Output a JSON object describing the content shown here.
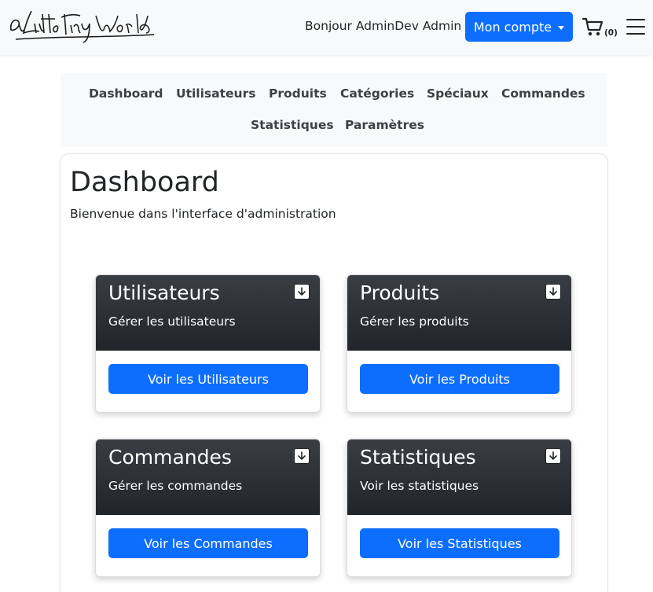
{
  "header": {
    "logo_text": "a Little Tiny World",
    "greeting": "Bonjour AdminDev Admin",
    "account_button": "Mon compte",
    "cart_count": "(0)",
    "accent_color": "#0d6efd"
  },
  "nav": {
    "items": [
      {
        "label": "Dashboard"
      },
      {
        "label": "Utilisateurs"
      },
      {
        "label": "Produits"
      },
      {
        "label": "Catégories"
      },
      {
        "label": "Spéciaux"
      },
      {
        "label": "Commandes"
      },
      {
        "label": "Statistiques"
      },
      {
        "label": "Paramètres"
      }
    ]
  },
  "main": {
    "title": "Dashboard",
    "subtitle": "Bienvenue dans l'interface d'administration",
    "cards": [
      {
        "title": "Utilisateurs",
        "description": "Gérer les utilisateurs",
        "button": "Voir les Utilisateurs",
        "icon": "download-icon"
      },
      {
        "title": "Produits",
        "description": "Gérer les produits",
        "button": "Voir les Produits",
        "icon": "download-icon"
      },
      {
        "title": "Commandes",
        "description": "Gérer les commandes",
        "button": "Voir les Commandes",
        "icon": "download-icon"
      },
      {
        "title": "Statistiques",
        "description": "Voir les statistiques",
        "button": "Voir les Statistiques",
        "icon": "download-icon"
      }
    ]
  }
}
